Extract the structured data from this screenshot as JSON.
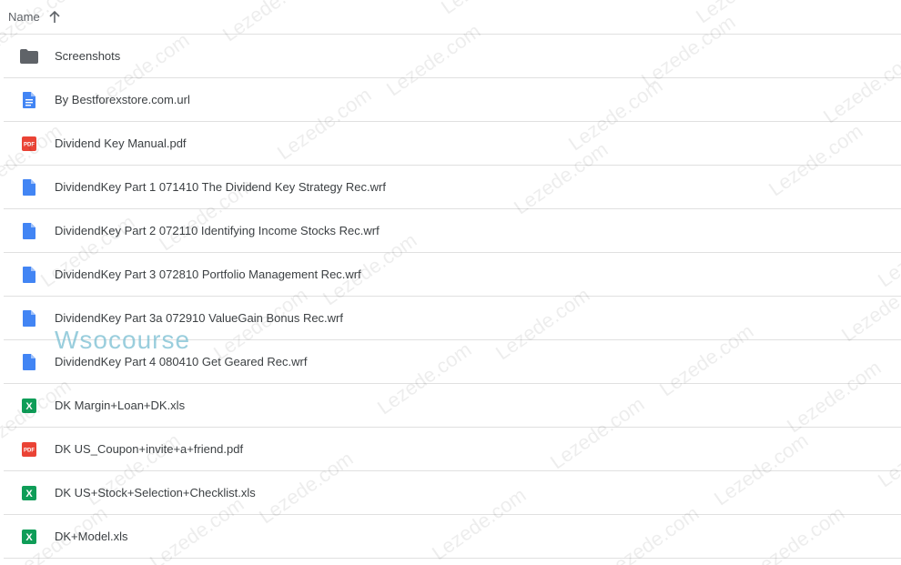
{
  "header": {
    "name_label": "Name",
    "sort_icon": "arrow-up-icon"
  },
  "colors": {
    "folder": "#5f6368",
    "doc": "#4285f4",
    "pdf": "#ea4335",
    "sheet": "#0f9d58",
    "text": "#3c4043",
    "divider": "#e0e0e0"
  },
  "files": [
    {
      "name": "Screenshots",
      "icon": "folder"
    },
    {
      "name": "By Bestforexstore.com.url",
      "icon": "doc-lines"
    },
    {
      "name": "Dividend Key Manual.pdf",
      "icon": "pdf"
    },
    {
      "name": "DividendKey Part 1 071410 The Dividend Key Strategy Rec.wrf",
      "icon": "doc"
    },
    {
      "name": "DividendKey Part 2 072110 Identifying Income Stocks Rec.wrf",
      "icon": "doc"
    },
    {
      "name": "DividendKey Part 3 072810 Portfolio Management Rec.wrf",
      "icon": "doc"
    },
    {
      "name": "DividendKey Part 3a 072910 ValueGain Bonus Rec.wrf",
      "icon": "doc"
    },
    {
      "name": "DividendKey Part 4 080410 Get Geared Rec.wrf",
      "icon": "doc"
    },
    {
      "name": "DK Margin+Loan+DK.xls",
      "icon": "sheet"
    },
    {
      "name": "DK US_Coupon+invite+a+friend.pdf",
      "icon": "pdf"
    },
    {
      "name": "DK US+Stock+Selection+Checklist.xls",
      "icon": "sheet"
    },
    {
      "name": "DK+Model.xls",
      "icon": "sheet"
    }
  ],
  "watermark": {
    "text": "Lezede.com",
    "brand": "Wsocourse"
  }
}
